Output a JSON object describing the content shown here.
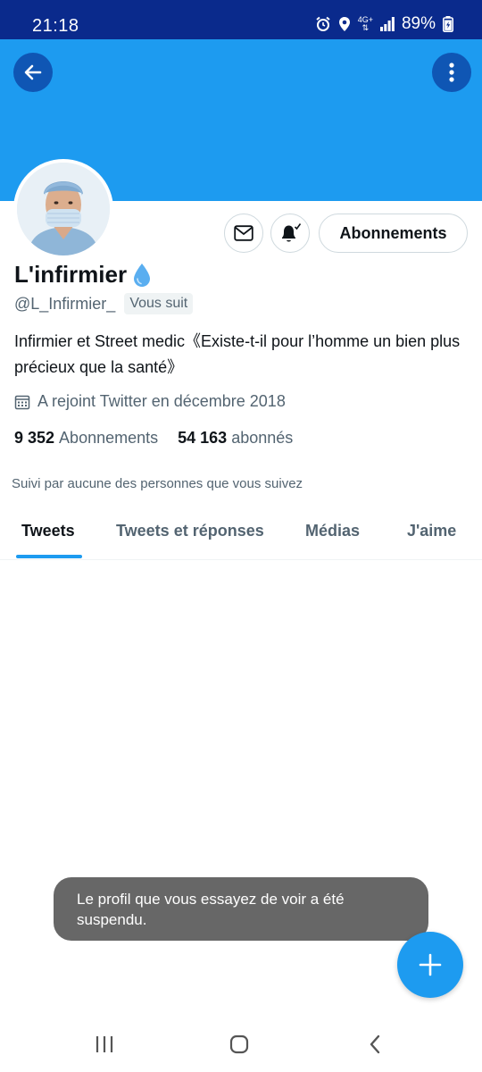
{
  "status_bar": {
    "time": "21:18",
    "network_top": "4G+",
    "battery_percent": "89%",
    "icons": [
      "alarm-icon",
      "location-icon",
      "network-icon",
      "signal-icon",
      "battery-icon"
    ]
  },
  "header": {
    "banner_color": "#1d9bf0",
    "back_icon": "arrow-left-icon",
    "more_icon": "more-vertical-icon"
  },
  "profile": {
    "display_name": "L'infirmier",
    "name_emoji": "💧",
    "handle": "@L_Infirmier_",
    "follows_you": "Vous suit",
    "bio": "Infirmier et Street medic《Existe-t-il pour l’homme un bien plus précieux que la santé》",
    "joined": "A rejoint Twitter en décembre 2018",
    "following_count": "9 352",
    "following_label": "Abonnements",
    "followers_count": "54 163",
    "followers_label": "abonnés",
    "followed_by": "Suivi par aucune des personnes que vous suivez"
  },
  "actions": {
    "message_icon": "envelope-icon",
    "notification_icon": "bell-check-icon",
    "follow_label": "Abonnements"
  },
  "tabs": [
    {
      "label": "Tweets",
      "active": true
    },
    {
      "label": "Tweets et réponses",
      "active": false
    },
    {
      "label": "Médias",
      "active": false
    },
    {
      "label": "J'aime",
      "active": false
    }
  ],
  "toast": {
    "message": "Le profil que vous essayez de voir a été suspendu."
  },
  "fab": {
    "icon": "plus-icon"
  },
  "nav": {
    "icons": [
      "recent-apps-icon",
      "home-icon",
      "back-icon"
    ]
  },
  "colors": {
    "accent": "#1d9bf0",
    "status_bar": "#0a2a8c",
    "toast_bg": "#676767"
  }
}
